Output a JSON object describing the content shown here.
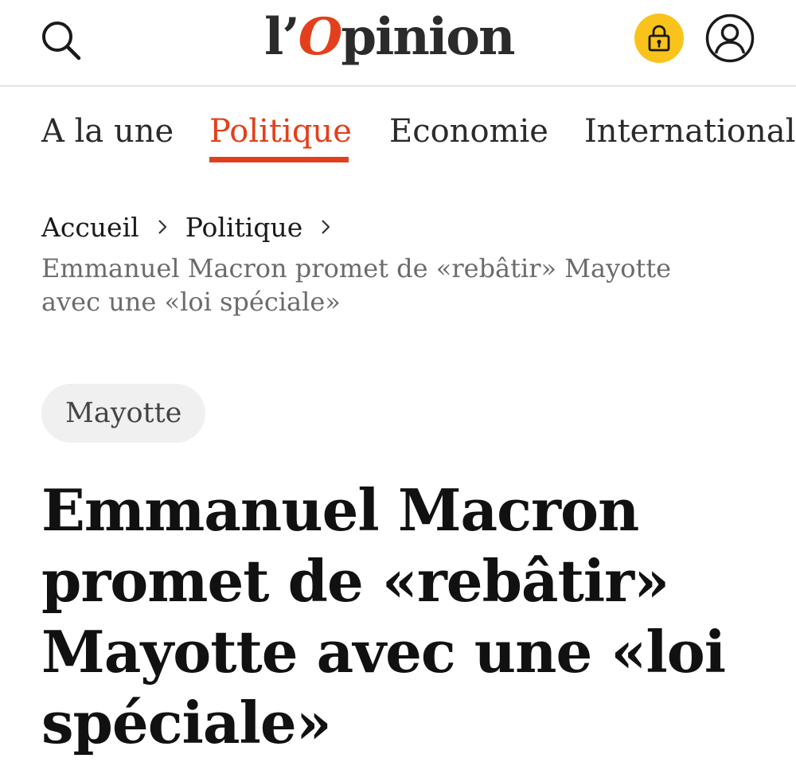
{
  "header": {
    "logo": {
      "prefix": "l’",
      "accent": "O",
      "suffix": "pinion"
    },
    "search_icon": "search-icon",
    "lock_icon": "lock-icon",
    "account_icon": "user-account-icon",
    "colors": {
      "accent": "#e2401c",
      "lock_bg": "#f9c31b"
    }
  },
  "nav": {
    "tabs": [
      {
        "label": "A la une",
        "active": false
      },
      {
        "label": "Politique",
        "active": true
      },
      {
        "label": "Economie",
        "active": false
      },
      {
        "label": "International",
        "active": false
      }
    ]
  },
  "breadcrumb": {
    "items": [
      {
        "label": "Accueil"
      },
      {
        "label": "Politique"
      }
    ],
    "separator_icon": "chevron-right-icon",
    "current": "Emmanuel Macron promet de «rebâtir» Mayotte avec une «loi spéciale»"
  },
  "article": {
    "tag": "Mayotte",
    "headline": "Emmanuel Macron promet de «rebâtir» Mayotte avec une «loi spéciale»"
  }
}
